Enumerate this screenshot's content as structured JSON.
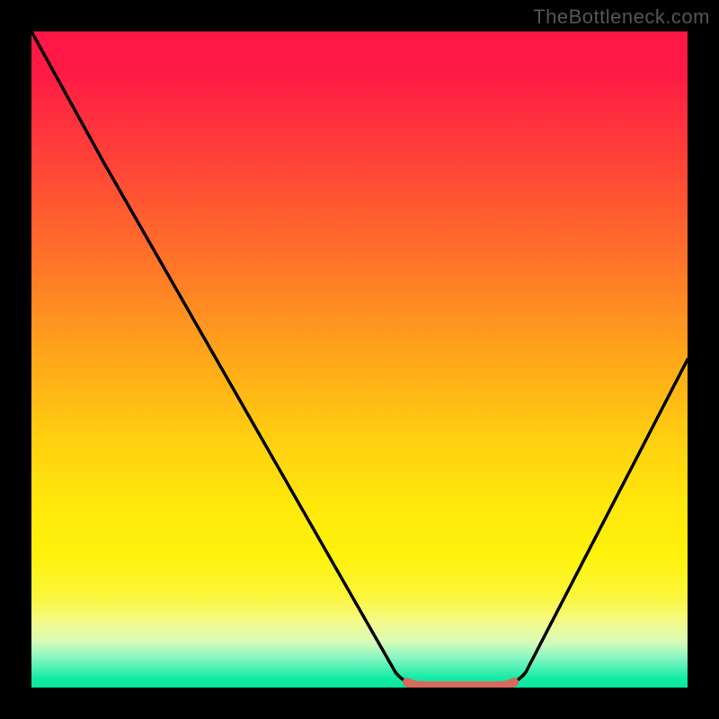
{
  "watermark": "TheBottleneck.com",
  "chart_data": {
    "type": "line",
    "title": "",
    "xlabel": "",
    "ylabel": "",
    "xlim": [
      0,
      100
    ],
    "ylim": [
      0,
      100
    ],
    "series": [
      {
        "name": "bottleneck-curve",
        "x": [
          0,
          5,
          10,
          15,
          20,
          25,
          30,
          35,
          40,
          45,
          50,
          55,
          58,
          60,
          63,
          66,
          69,
          72,
          75,
          80,
          85,
          90,
          95,
          100
        ],
        "values": [
          100,
          93,
          85,
          77,
          69,
          60,
          52,
          44,
          35,
          27,
          18,
          9,
          3,
          0.5,
          0,
          0,
          0,
          0.5,
          3,
          10,
          19,
          29,
          39,
          50
        ]
      },
      {
        "name": "optimal-range-marker",
        "x": [
          60,
          63,
          66,
          69,
          72
        ],
        "values": [
          0.5,
          0,
          0,
          0,
          0.5
        ]
      }
    ],
    "annotations": {
      "optimal_range_color": "#d66a5e",
      "optimal_range_x": [
        60,
        72
      ]
    },
    "background_gradient_stops": [
      {
        "pct": 0,
        "color": "#ff1646"
      },
      {
        "pct": 50,
        "color": "#ffae18"
      },
      {
        "pct": 80,
        "color": "#fff20c"
      },
      {
        "pct": 95,
        "color": "#97f7c2"
      },
      {
        "pct": 100,
        "color": "#08e99e"
      }
    ]
  }
}
